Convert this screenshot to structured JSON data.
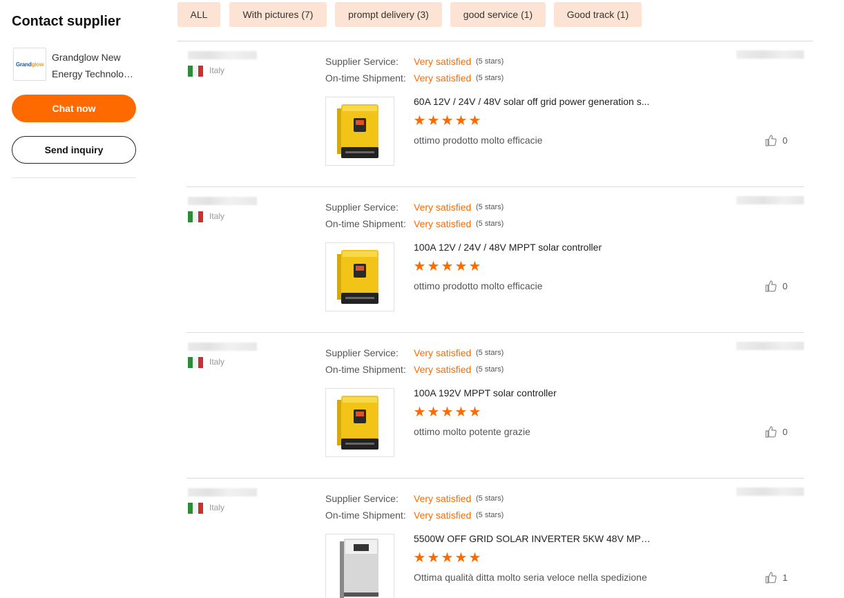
{
  "sidebar": {
    "title": "Contact supplier",
    "supplier_name_line1": "Grandglow New",
    "supplier_name_line2": "Energy Technolog...",
    "chat_label": "Chat now",
    "inquiry_label": "Send inquiry"
  },
  "filters": [
    {
      "label": "ALL"
    },
    {
      "label": "With pictures (7)"
    },
    {
      "label": "prompt delivery (3)"
    },
    {
      "label": "good service (1)"
    },
    {
      "label": "Good track (1)"
    }
  ],
  "review_labels": {
    "supplier_service": "Supplier Service:",
    "on_time_shipment": "On-time Shipment:"
  },
  "reviews": [
    {
      "country": "Italy",
      "supplier_service_rating": "Very satisfied",
      "supplier_service_stars": "(5 stars)",
      "shipment_rating": "Very satisfied",
      "shipment_stars": "(5 stars)",
      "product_title": "60A 12V / 24V / 48V solar off grid power generation s...",
      "stars": 5,
      "comment": "ottimo prodotto molto efficacie",
      "likes": "0"
    },
    {
      "country": "Italy",
      "supplier_service_rating": "Very satisfied",
      "supplier_service_stars": "(5 stars)",
      "shipment_rating": "Very satisfied",
      "shipment_stars": "(5 stars)",
      "product_title": "100A 12V / 24V / 48V MPPT solar controller",
      "stars": 5,
      "comment": "ottimo prodotto molto efficacie",
      "likes": "0"
    },
    {
      "country": "Italy",
      "supplier_service_rating": "Very satisfied",
      "supplier_service_stars": "(5 stars)",
      "shipment_rating": "Very satisfied",
      "shipment_stars": "(5 stars)",
      "product_title": "100A 192V MPPT solar controller",
      "stars": 5,
      "comment": "ottimo molto potente grazie",
      "likes": "0"
    },
    {
      "country": "Italy",
      "supplier_service_rating": "Very satisfied",
      "supplier_service_stars": "(5 stars)",
      "shipment_rating": "Very satisfied",
      "shipment_stars": "(5 stars)",
      "product_title": "5500W OFF GRID SOLAR INVERTER 5KW 48V MPPT ...",
      "stars": 5,
      "comment": "Ottima qualità ditta molto seria veloce nella spedizione",
      "likes": "1"
    }
  ],
  "colors": {
    "accent": "#ff6a00",
    "chip_bg": "#fde3d4",
    "divider": "#d9d9d9"
  }
}
